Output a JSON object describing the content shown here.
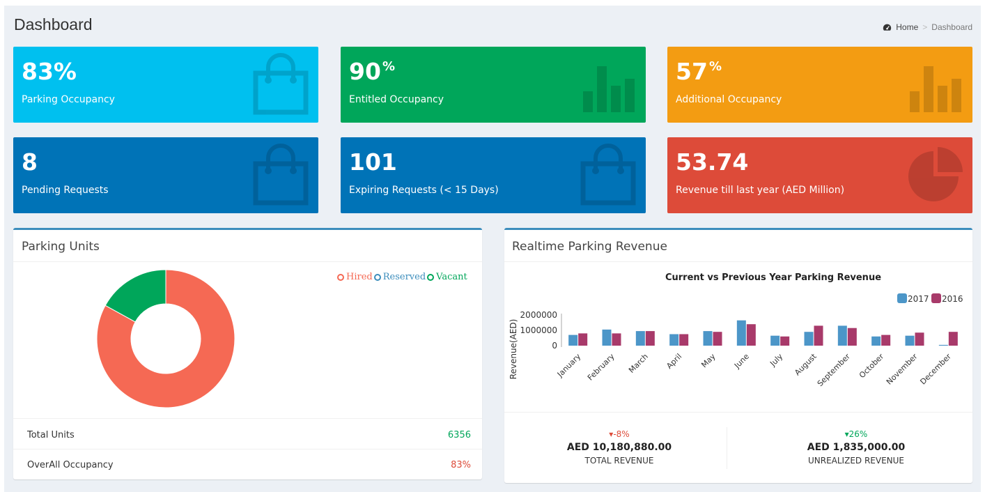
{
  "header": {
    "title": "Dashboard",
    "breadcrumb": {
      "home": "Home",
      "current": "Dashboard",
      "separator": ">"
    }
  },
  "tiles": [
    {
      "value": "83%",
      "suffix": "",
      "label": "Parking Occupancy",
      "color": "#00c0ef",
      "icon": "shopping-bag-icon"
    },
    {
      "value": "90",
      "suffix": "%",
      "label": "Entitled Occupancy",
      "color": "#00a65a",
      "icon": "bar-chart-icon"
    },
    {
      "value": "57",
      "suffix": "%",
      "label": "Additional Occupancy",
      "color": "#f39c12",
      "icon": "bar-chart-icon"
    },
    {
      "value": "8",
      "suffix": "",
      "label": "Pending Requests",
      "color": "#0073b7",
      "icon": "shopping-bag-icon"
    },
    {
      "value": "101",
      "suffix": "",
      "label": "Expiring Requests (< 15 Days)",
      "color": "#0073b7",
      "icon": "shopping-bag-icon"
    },
    {
      "value": "53.74",
      "suffix": "",
      "label": "Revenue till last year (AED Million)",
      "color": "#dd4b39",
      "icon": "pie-chart-icon"
    }
  ],
  "parking_units": {
    "title": "Parking Units",
    "legend": [
      {
        "label": "Hired",
        "color": "#f56954"
      },
      {
        "label": "Reserved",
        "color": "#3c8dbc"
      },
      {
        "label": "Vacant",
        "color": "#00a65a"
      }
    ],
    "rows": [
      {
        "label": "Total Units",
        "value": "6356",
        "color": "#00a65a"
      },
      {
        "label": "OverAll Occupancy",
        "value": "83%",
        "color": "#dd4b39"
      }
    ]
  },
  "revenue": {
    "title": "Realtime Parking Revenue",
    "summary": [
      {
        "pct": "▾-8%",
        "pct_color": "#dd4b39",
        "amount": "AED 10,180,880.00",
        "caption": "TOTAL REVENUE"
      },
      {
        "pct": "▾26%",
        "pct_color": "#00a65a",
        "amount": "AED 1,835,000.00",
        "caption": "UNREALIZED REVENUE"
      }
    ]
  },
  "chart_data": [
    {
      "type": "pie",
      "categories": [
        "Hired",
        "Reserved",
        "Vacant"
      ],
      "values": [
        83,
        0,
        17
      ],
      "colors": [
        "#f56954",
        "#3c8dbc",
        "#00a65a"
      ],
      "donut": true
    },
    {
      "type": "bar",
      "title": "Current vs Previous Year Parking Revenue",
      "ylabel": "Revenue(AED)",
      "categories": [
        "January",
        "February",
        "March",
        "April",
        "May",
        "June",
        "July",
        "August",
        "September",
        "October",
        "November",
        "December"
      ],
      "series": [
        {
          "name": "2017",
          "color": "#4c96c8",
          "values": [
            700000,
            1050000,
            950000,
            750000,
            950000,
            1650000,
            650000,
            900000,
            1300000,
            600000,
            650000,
            50000
          ]
        },
        {
          "name": "2016",
          "color": "#a83a6a",
          "values": [
            800000,
            800000,
            950000,
            750000,
            900000,
            1400000,
            600000,
            1300000,
            1150000,
            700000,
            850000,
            900000
          ]
        }
      ],
      "yticks": [
        "0",
        "1000000",
        "2000000"
      ],
      "ylim": [
        0,
        2000000
      ],
      "legend_position": "top-right",
      "grid": false
    }
  ]
}
